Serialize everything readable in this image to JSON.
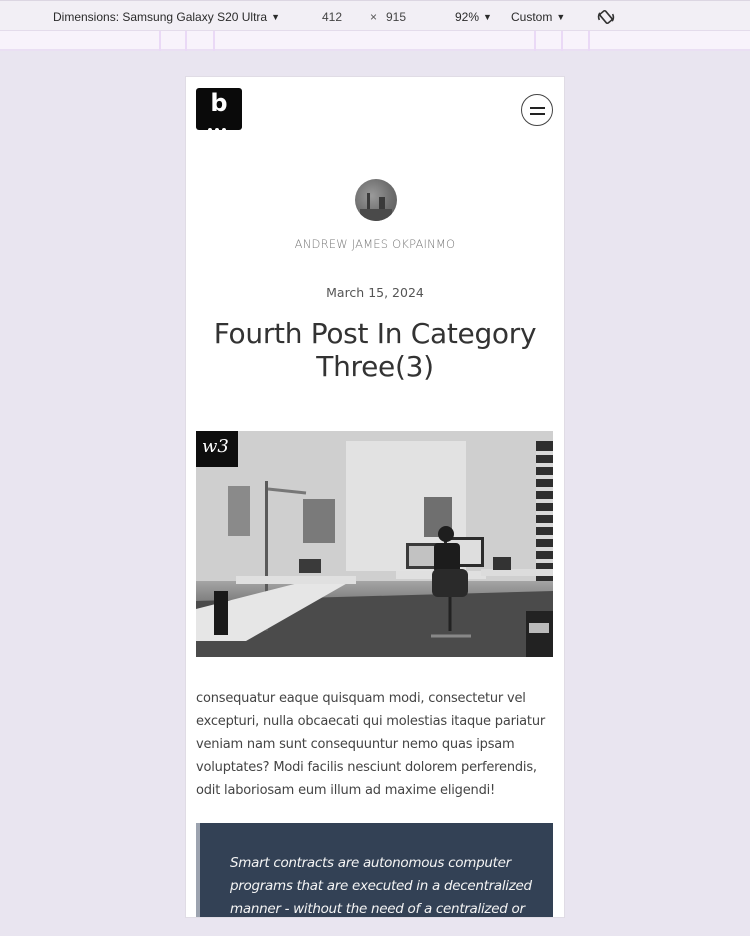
{
  "devtools": {
    "dimensions_label": "Dimensions: Samsung Galaxy S20 Ultra",
    "width_value": "412",
    "times_symbol": "×",
    "height_value": "915",
    "zoom_value": "92%",
    "throttle_value": "Custom",
    "caret": "▼"
  },
  "site": {
    "logo_letter": "b",
    "menu_label": "Open menu"
  },
  "post": {
    "author": "ANDREW JAMES OKPAINMO",
    "date": "March 15, 2024",
    "title": "Fourth Post In Category Three(3)",
    "image_badge": "w3",
    "image_alt": "Office workspace with desks, lamps and a person working at a computer",
    "paragraph": "consequatur eaque quisquam modi, consectetur vel excepturi, nulla obcaecati qui molestias itaque pariatur veniam nam sunt consequuntur nemo quas ipsam voluptates? Modi facilis nesciunt dolorem perferendis, odit laboriosam eum illum ad maxime eligendi!",
    "quote": "Smart contracts are autonomous computer programs that are executed in a decentralized manner - without the need of a centralized or"
  },
  "colors": {
    "quote_bg": "#334155",
    "quote_border": "#9ca3af",
    "page_bg": "#e9e5f0"
  }
}
